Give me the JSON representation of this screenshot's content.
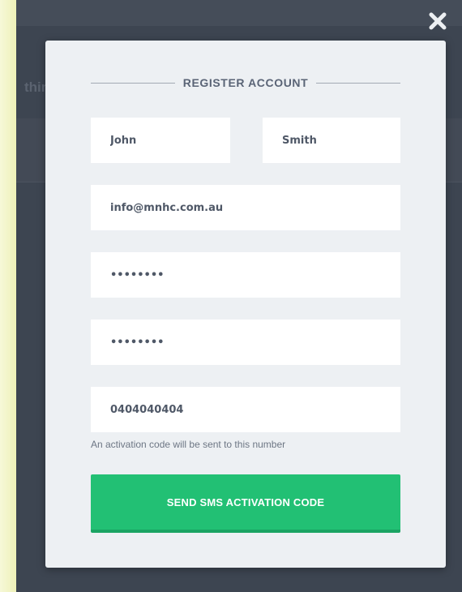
{
  "background": {
    "partial_text": "thir"
  },
  "modal": {
    "title": "REGISTER ACCOUNT",
    "first_name": "John",
    "last_name": "Smith",
    "email": "info@mnhc.com.au",
    "password": "••••••••",
    "confirm_password": "••••••••",
    "phone": "0404040404",
    "phone_hint": "An activation code will be sent to this number",
    "submit_label": "SEND SMS ACTIVATION CODE"
  },
  "icons": {
    "close": "close-icon"
  },
  "colors": {
    "accent": "#22c074",
    "modal_bg": "#edf0f3",
    "backdrop": "#3d4551",
    "title_text": "#5a6476"
  }
}
